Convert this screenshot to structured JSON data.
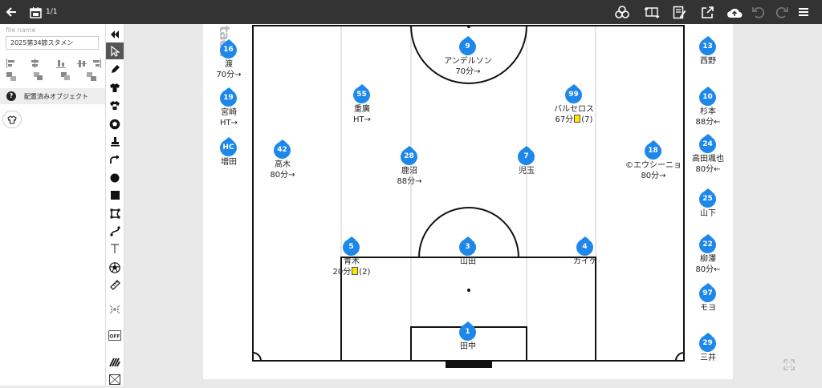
{
  "app": {
    "page_count": "1/1"
  },
  "file": {
    "label": "file name",
    "value": "2025第34節スタメン"
  },
  "placed_objects": {
    "label": "配置済みオブジェクト"
  },
  "watermark": {
    "text": "tacti"
  },
  "colors": {
    "player": "#1d87ea",
    "yellow_card": "#ffe600",
    "topbar": "#333333"
  },
  "players": [
    {
      "id": "p16",
      "number": "16",
      "name": "渡",
      "sub": "70分→"
    },
    {
      "id": "p19",
      "number": "19",
      "name": "宮崎",
      "sub": "HT→"
    },
    {
      "id": "phc",
      "number": "HC",
      "name": "増田",
      "sub": ""
    },
    {
      "id": "p42",
      "number": "42",
      "name": "高木",
      "sub": "80分→"
    },
    {
      "id": "p55",
      "number": "55",
      "name": "重廣",
      "sub": "HT→"
    },
    {
      "id": "p9",
      "number": "9",
      "name": "アンデルソン",
      "sub": "70分→"
    },
    {
      "id": "p28",
      "number": "28",
      "name": "鹿沼",
      "sub": "88分→"
    },
    {
      "id": "p99",
      "number": "99",
      "name": "バルセロス",
      "sub_pre": "67分",
      "card": true,
      "sub_post": "(7)"
    },
    {
      "id": "p7",
      "number": "7",
      "name": "児玉",
      "sub": ""
    },
    {
      "id": "p18",
      "number": "18",
      "name": "©エウシーニョ",
      "sub": "80分→"
    },
    {
      "id": "p5",
      "number": "5",
      "name": "青木",
      "sub_pre": "20分",
      "card": true,
      "sub_post": "(2)"
    },
    {
      "id": "p3",
      "number": "3",
      "name": "山田",
      "sub": ""
    },
    {
      "id": "p4",
      "number": "4",
      "name": "カイケ",
      "sub": ""
    },
    {
      "id": "p1",
      "number": "1",
      "name": "田中",
      "sub": ""
    },
    {
      "id": "p13",
      "number": "13",
      "name": "西野",
      "sub": ""
    },
    {
      "id": "p10",
      "number": "10",
      "name": "杉本",
      "sub": "88分←"
    },
    {
      "id": "p24",
      "number": "24",
      "name": "高田颯也",
      "sub": "80分←"
    },
    {
      "id": "p25",
      "number": "25",
      "name": "山下",
      "sub": ""
    },
    {
      "id": "p22",
      "number": "22",
      "name": "柳澤",
      "sub": "80分←"
    },
    {
      "id": "p97",
      "number": "97",
      "name": "モヨ",
      "sub": ""
    },
    {
      "id": "p29",
      "number": "29",
      "name": "三井",
      "sub": ""
    }
  ]
}
